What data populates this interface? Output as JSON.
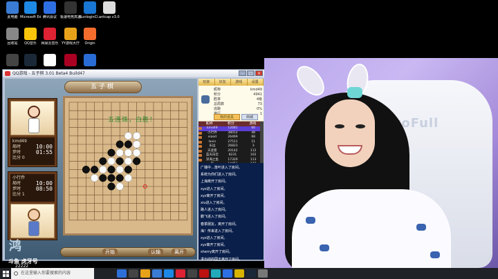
{
  "desktop": {
    "icons": [
      {
        "label": "此电脑",
        "color": "#3a7bd5"
      },
      {
        "label": "Microsoft Edge",
        "color": "#1e88e5"
      },
      {
        "label": "腾讯会议",
        "color": "#2f6fe4"
      },
      {
        "label": "极速电竞高速器",
        "color": "#333"
      },
      {
        "label": "SunloginCl...",
        "color": "#1976d2"
      },
      {
        "label": "antcap v3.0.8.exe",
        "color": "#ddd"
      },
      {
        "label": "回收站",
        "color": "#888"
      },
      {
        "label": "QQ音乐",
        "color": "#f9c50b"
      },
      {
        "label": "网易云音乐",
        "color": "#d23"
      },
      {
        "label": "YY游戏大厅",
        "color": "#e8a21a"
      },
      {
        "label": "Origin",
        "color": "#f56c2d"
      },
      {
        "label": "",
        "color": "#444"
      },
      {
        "label": "",
        "color": "#1b2838"
      },
      {
        "label": "",
        "color": "#fff"
      },
      {
        "label": "",
        "color": "#a02"
      },
      {
        "label": "",
        "color": "#2a6cd6"
      }
    ]
  },
  "game": {
    "title": "QQ游戏 - 五子棋 3.01 Beta4 Build47",
    "banner": "五子棋",
    "win_message": "五连珠，白胜！",
    "players": [
      {
        "name": "kmd49",
        "label1": "局时",
        "time1": "10:00",
        "label2": "步时",
        "time2": "01:55",
        "status": "比分 0"
      },
      {
        "name": "小行乔",
        "label1": "局时",
        "time1": "10:00",
        "label2": "步时",
        "time2": "08:50",
        "status": "比分 1"
      }
    ],
    "buttons": {
      "surrender": "认输",
      "restart": "开始",
      "exit": "离开"
    },
    "logo_text": "鸿"
  },
  "side": {
    "tabs": [
      "玩家",
      "好友",
      "游戏",
      "设置"
    ],
    "profile": {
      "fields": [
        [
          "昵称",
          "kmd49"
        ],
        [
          "积分",
          "4941"
        ],
        [
          "胜率",
          "4级"
        ],
        [
          "总局数",
          "73"
        ],
        [
          "逃跑",
          "0%"
        ],
        [
          "排行",
          "1"
        ]
      ],
      "button": "我的道具",
      "button2": "商城"
    },
    "players_header": [
      "昵称",
      "积分",
      "游戏"
    ],
    "player_rows": [
      [
        "kmd49",
        "12681",
        "66"
      ],
      [
        "小行乔",
        "38012",
        "48"
      ],
      [
        "xiaod",
        "26469",
        "68"
      ],
      [
        "lavin",
        "27511",
        "11"
      ],
      [
        "乐远",
        "26823",
        "3"
      ],
      [
        "天涯客",
        "20142",
        "112"
      ],
      [
        "蓝天白云",
        "8231",
        "102"
      ],
      [
        "深海之鱼",
        "17329",
        "113"
      ],
      [
        "彩",
        "14451",
        "142"
      ]
    ],
    "chat": [
      "广播中...落叶进入了房间。",
      "系统为你们进入了房间。",
      "上海离开了房间。",
      "xyz进入了房间。",
      "xyz离开了房间。",
      "xiu进入了房间。",
      "路人进入了房间。",
      "鹏飞进入了房间。",
      "春季朋友，离开了房间。",
      "海！传来进入了房间。",
      "xyz进入了房间。",
      "xyz离开了房间。",
      "sherry离开了房间。",
      "求出线的国王离开了房间。"
    ]
  },
  "webcam": {
    "chair_brand": "AutoFull"
  },
  "stream_overlay": {
    "logo": "斗鱼 虎牙号",
    "number": "22222"
  },
  "taskbar": {
    "search_placeholder": "在这里输入你要搜索的内容",
    "apps": [
      "#2d6fd8",
      "#444",
      "#e8a21a",
      "#3a7bd5",
      "#1e88e5",
      "#d23",
      "#444",
      "#b11",
      "#2ab",
      "#2f6fe4",
      "#d6b400",
      "#1b2838",
      "#777"
    ]
  }
}
